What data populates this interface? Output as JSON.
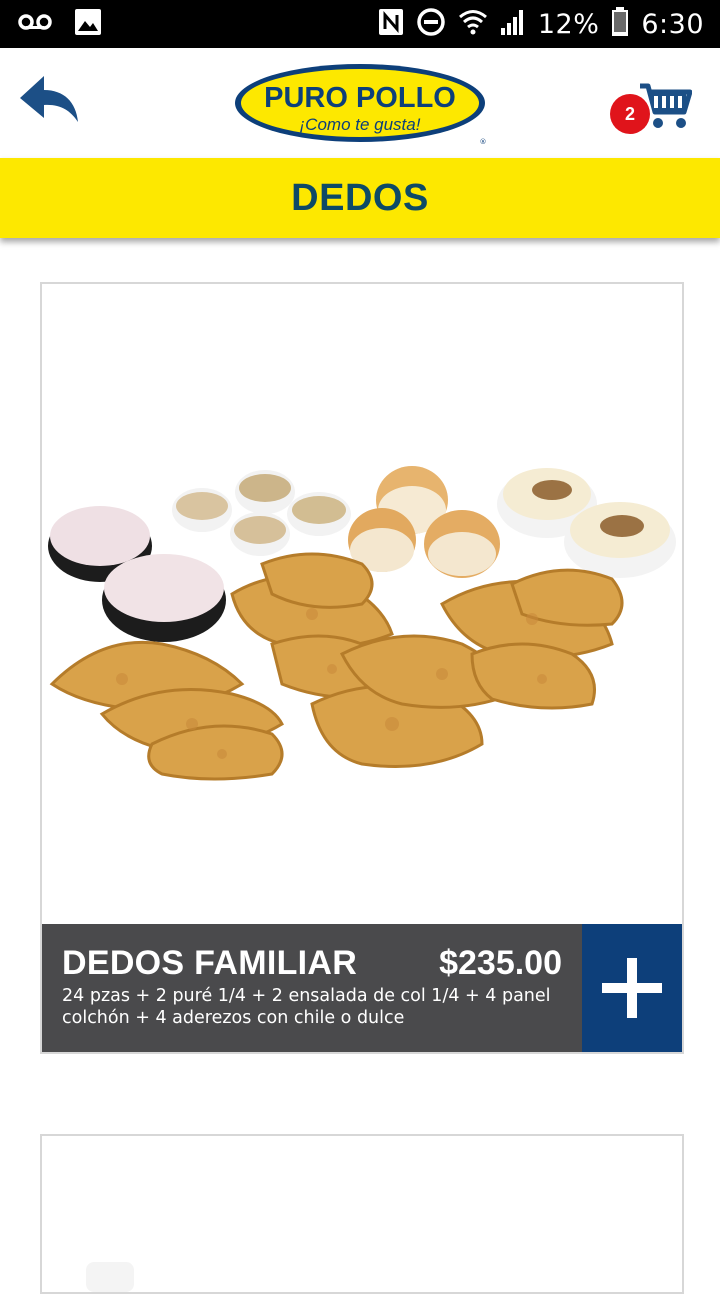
{
  "status_bar": {
    "battery_percent": "12%",
    "time": "6:30",
    "icons": [
      "voicemail-icon",
      "image-icon",
      "nfc-icon",
      "do-not-disturb-icon",
      "wifi-icon",
      "signal-icon",
      "battery-icon"
    ]
  },
  "header": {
    "logo_brand": "PURO POLLO",
    "logo_tagline": "¡Como te gusta!",
    "cart_count": "2",
    "icons": [
      "back-arrow-icon",
      "cart-icon"
    ]
  },
  "page": {
    "title": "DEDOS"
  },
  "products": [
    {
      "name": "DEDOS FAMILIAR",
      "price": "$235.00",
      "description": "24 pzas + 2 puré 1/4 + 2 ensalada de col 1/4 + 4 panel colchón + 4 aderezos con chile o dulce",
      "add_icon": "plus-icon"
    }
  ],
  "colors": {
    "title_bar": "#fde800",
    "title_text": "#0d4a66",
    "footer_bg": "#4a4a4c",
    "add_button": "#0d3f7a",
    "badge": "#e0141b"
  }
}
